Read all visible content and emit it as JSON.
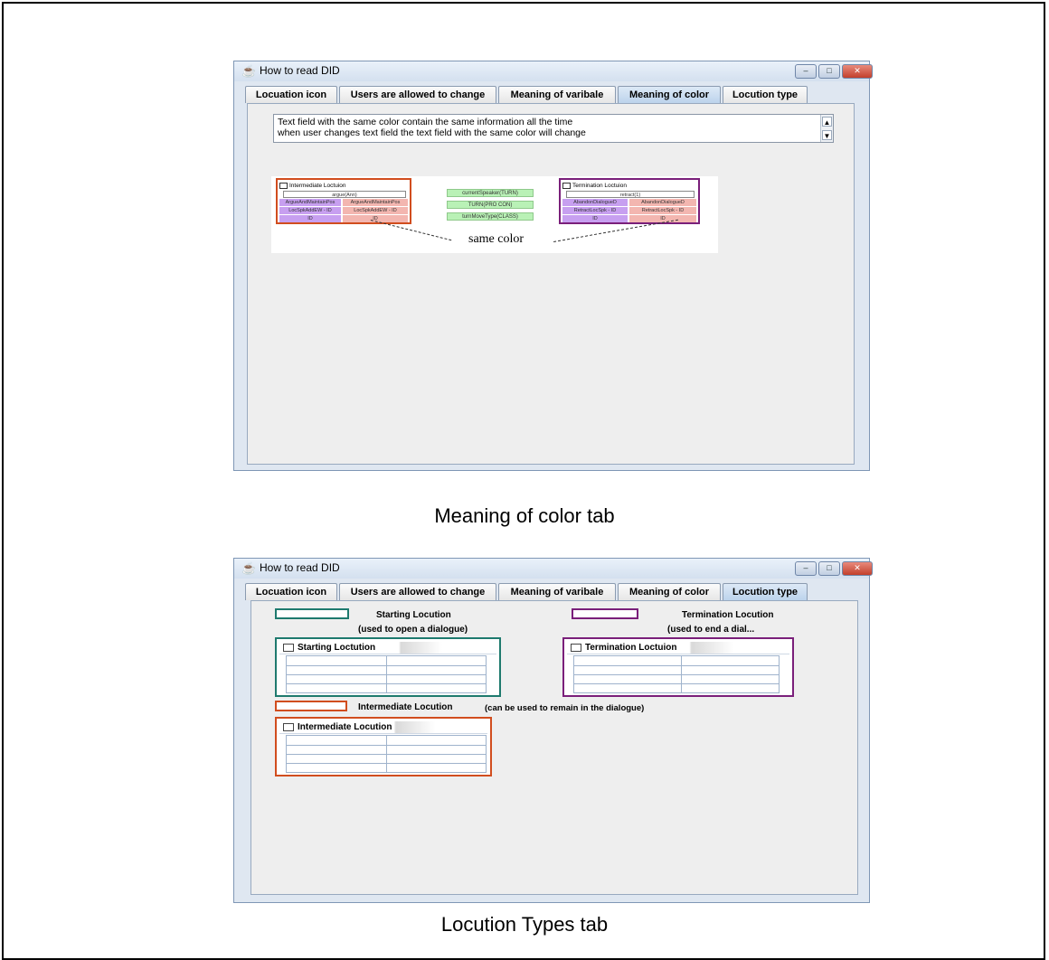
{
  "window_top": {
    "title": "How to read DID",
    "tabs": [
      "Locuation icon",
      "Users are allowed to change",
      "Meaning of varibale",
      "Meaning of color",
      "Locution type"
    ],
    "selected_tab": "Meaning of color",
    "textarea_lines": [
      "Text field with the same color contain the same information all the time",
      "when user changes text field the text field with the same color will change"
    ],
    "figure": {
      "left_box_title": "Intermediate Loctuion",
      "left_box_header": "argue(Ann)",
      "left_rows": [
        [
          "ArgueAndMaintainPos",
          "ArgueAndMaintainPos"
        ],
        [
          "LocSpkAddEW - ID",
          "LocSpkAddEW - ID"
        ],
        [
          "ID",
          "ID"
        ]
      ],
      "middle_boxes": [
        "currentSpeaker(TURN)",
        "TURN(PRO CON)",
        "turnMoveType(CLASS)"
      ],
      "right_box_title": "Termination Loctuion",
      "right_box_header": "retract(1)",
      "right_rows": [
        [
          "AbandonDialogueD",
          "AbandonDialogueD"
        ],
        [
          "RetractLocSpk - ID",
          "RetractLocSpk - ID"
        ],
        [
          "ID",
          "ID"
        ]
      ],
      "same_color_label": "same color"
    },
    "buttons": {
      "minimize": "–",
      "maximize": "□",
      "close": "✕"
    }
  },
  "caption_top": "Meaning of color tab",
  "window_bottom": {
    "title": "How to read DID",
    "tabs": [
      "Locuation icon",
      "Users are allowed to change",
      "Meaning of varibale",
      "Meaning of color",
      "Locution type"
    ],
    "selected_tab": "Locution type",
    "starting_label": "Starting Locution",
    "starting_sub": "(used to open a dialogue)",
    "termination_label": "Termination Locution",
    "termination_sub": "(used to end a dial...",
    "intermediate_label": "Intermediate Locution",
    "intermediate_sub": "(can be used to remain in the dialogue)",
    "starting_table_title": "Starting Loctution",
    "termination_table_title": "Termination Loctuion",
    "intermediate_table_title": "Intermediate Locution",
    "colors": {
      "starting": "#1e7a6e",
      "termination": "#7a1f7a",
      "intermediate": "#d14d1e"
    },
    "buttons": {
      "minimize": "–",
      "maximize": "□",
      "close": "✕"
    }
  },
  "caption_bottom": "Locution Types tab"
}
